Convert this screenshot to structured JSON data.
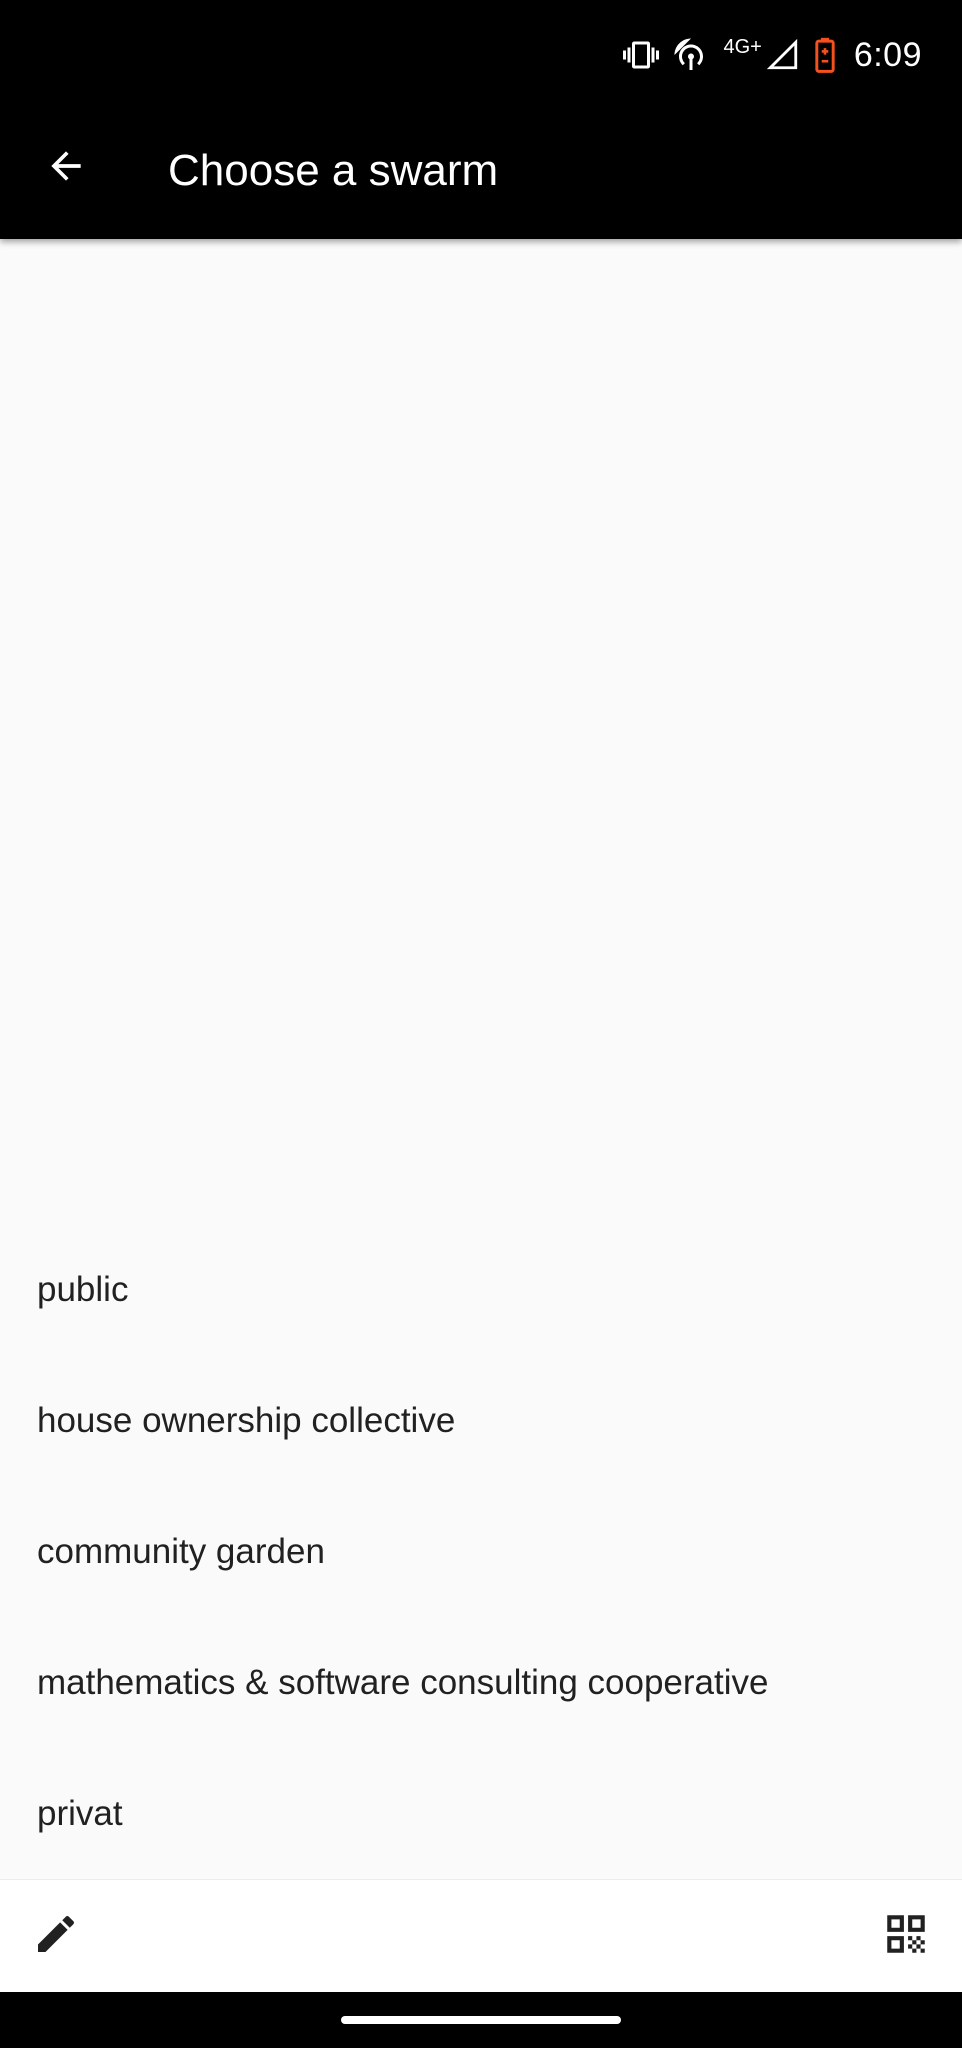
{
  "status_bar": {
    "time": "6:09",
    "network": "4G+",
    "icons": [
      "vibrate-icon",
      "hotspot-icon",
      "signal-icon",
      "battery-charging-icon"
    ],
    "battery_color": "#f4511e"
  },
  "app_bar": {
    "title": "Choose a swarm",
    "back_icon": "arrow-back-icon",
    "background": "#000000"
  },
  "swarms": [
    {
      "label": "public"
    },
    {
      "label": "house ownership collective"
    },
    {
      "label": "community garden"
    },
    {
      "label": "mathematics & software consulting cooperative"
    },
    {
      "label": "privat"
    }
  ],
  "bottom_bar": {
    "left_icon": "edit-icon",
    "right_icon": "qr-code-icon"
  }
}
